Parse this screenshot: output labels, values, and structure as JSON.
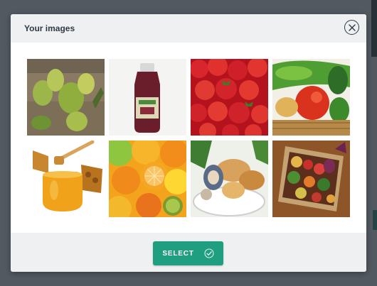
{
  "modal": {
    "title": "Your images",
    "select_label": "SELECT"
  },
  "images": [
    {
      "subject": "pears"
    },
    {
      "subject": "juice bottle"
    },
    {
      "subject": "strawberries"
    },
    {
      "subject": "vegetables"
    },
    {
      "subject": "honey"
    },
    {
      "subject": "citrus fruits"
    },
    {
      "subject": "bread basket"
    },
    {
      "subject": "vegetable crate"
    }
  ],
  "colors": {
    "accent": "#1f9e80",
    "title": "#2f3a44"
  }
}
